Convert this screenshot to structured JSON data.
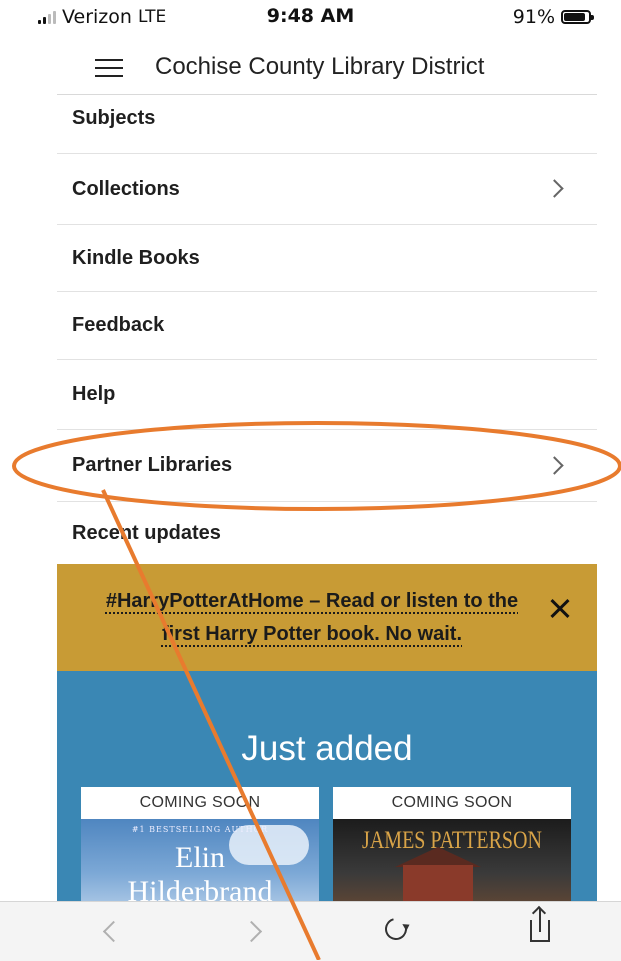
{
  "status_bar": {
    "carrier": "Verizon",
    "network": "LTE",
    "time": "9:48 AM",
    "battery": "91%"
  },
  "header": {
    "title": "Cochise County Library District"
  },
  "menu": {
    "items": [
      {
        "label": "Subjects",
        "has_submenu": false
      },
      {
        "label": "Collections",
        "has_submenu": true
      },
      {
        "label": "Kindle Books",
        "has_submenu": false
      },
      {
        "label": "Feedback",
        "has_submenu": false
      },
      {
        "label": "Help",
        "has_submenu": false
      },
      {
        "label": "Partner Libraries",
        "has_submenu": true
      },
      {
        "label": "Recent updates",
        "has_submenu": false
      }
    ]
  },
  "banner": {
    "text": "#HarryPotterAtHome – Read or listen to the first Harry Potter book. No wait."
  },
  "just_added": {
    "title": "Just added",
    "books": [
      {
        "badge": "COMING SOON",
        "cover_small": "#1 BESTSELLING AUTHOR",
        "cover_line1": "Elin",
        "cover_line2": "Hilderbrand"
      },
      {
        "badge": "COMING SOON",
        "cover_author": "JAMES PATTERSON"
      }
    ]
  },
  "colors": {
    "banner_bg": "#c89b35",
    "just_added_bg": "#3a87b4",
    "annotation": "#e87b2e"
  }
}
